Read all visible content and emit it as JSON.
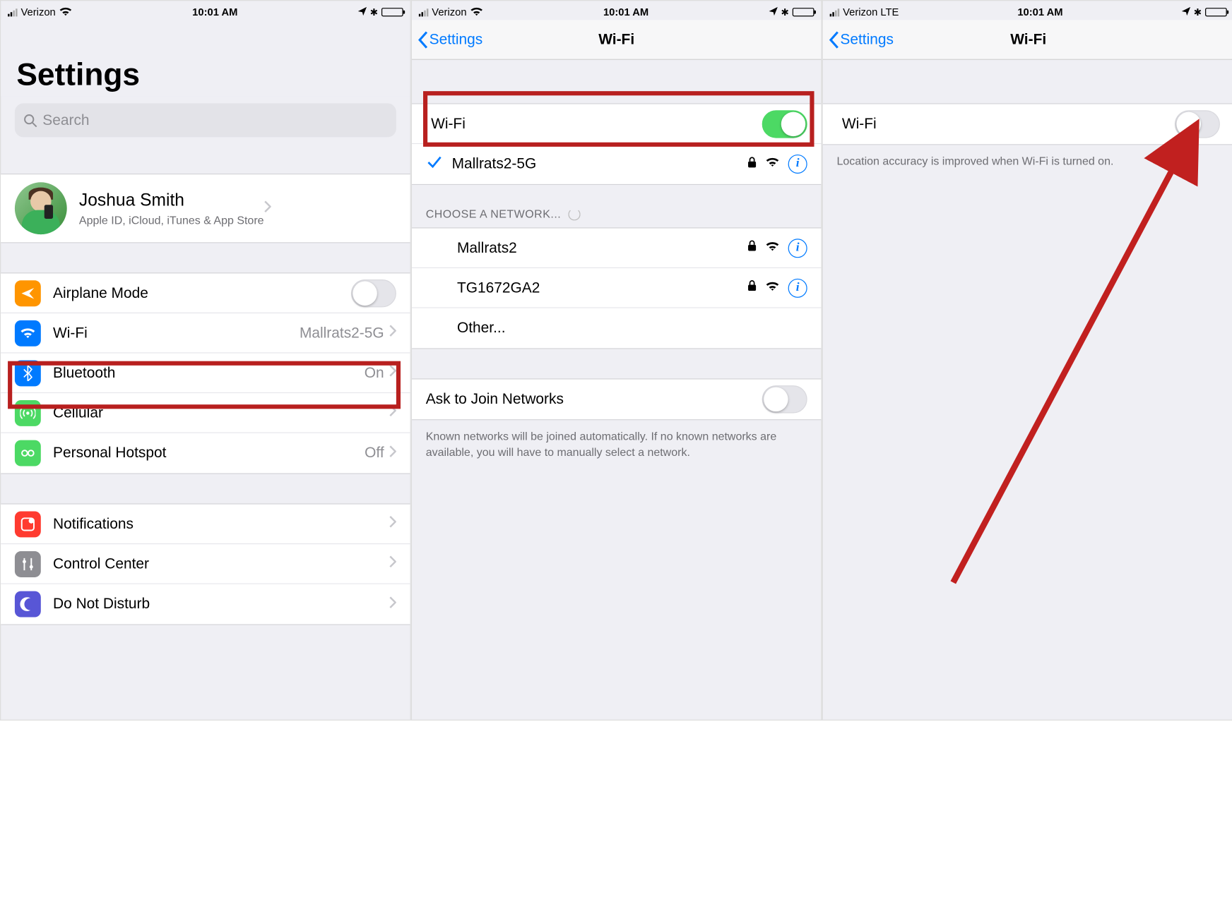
{
  "status": {
    "carrier_wifi": "Verizon",
    "carrier_lte": "Verizon  LTE",
    "time": "10:01 AM"
  },
  "screen1": {
    "title": "Settings",
    "search_placeholder": "Search",
    "profile": {
      "name": "Joshua Smith",
      "sub": "Apple ID, iCloud, iTunes & App Store"
    },
    "rows": {
      "airplane": "Airplane Mode",
      "wifi": "Wi-Fi",
      "wifi_detail": "Mallrats2-5G",
      "bluetooth": "Bluetooth",
      "bluetooth_detail": "On",
      "cellular": "Cellular",
      "hotspot": "Personal Hotspot",
      "hotspot_detail": "Off",
      "notifications": "Notifications",
      "control_center": "Control Center",
      "dnd": "Do Not Disturb"
    }
  },
  "screen2": {
    "back": "Settings",
    "title": "Wi-Fi",
    "wifi_label": "Wi-Fi",
    "connected": "Mallrats2-5G",
    "choose_header": "CHOOSE A NETWORK...",
    "networks": [
      "Mallrats2",
      "TG1672GA2"
    ],
    "other": "Other...",
    "ask": "Ask to Join Networks",
    "ask_note": "Known networks will be joined automatically. If no known networks are available, you will have to manually select a network."
  },
  "screen3": {
    "back": "Settings",
    "title": "Wi-Fi",
    "wifi_label": "Wi-Fi",
    "note": "Location accuracy is improved when Wi-Fi is turned on."
  }
}
